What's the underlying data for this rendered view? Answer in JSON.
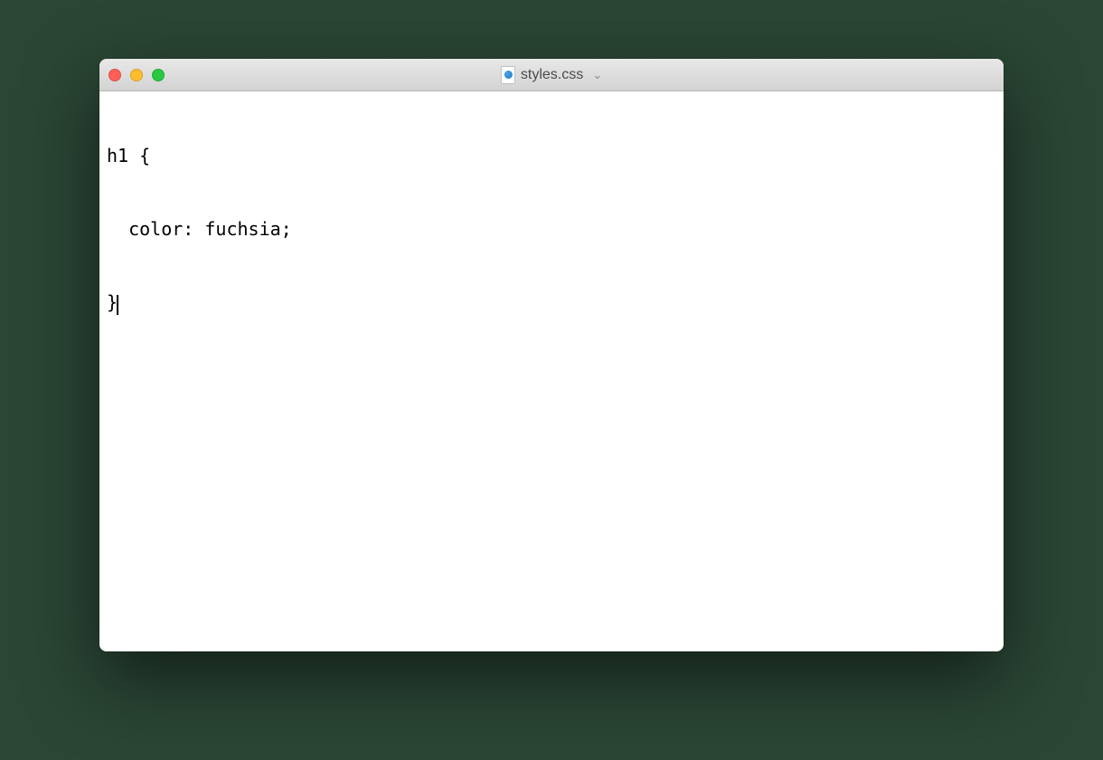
{
  "window": {
    "title": "styles.css"
  },
  "editor": {
    "lines": [
      "h1 {",
      "  color: fuchsia;",
      "}"
    ]
  }
}
